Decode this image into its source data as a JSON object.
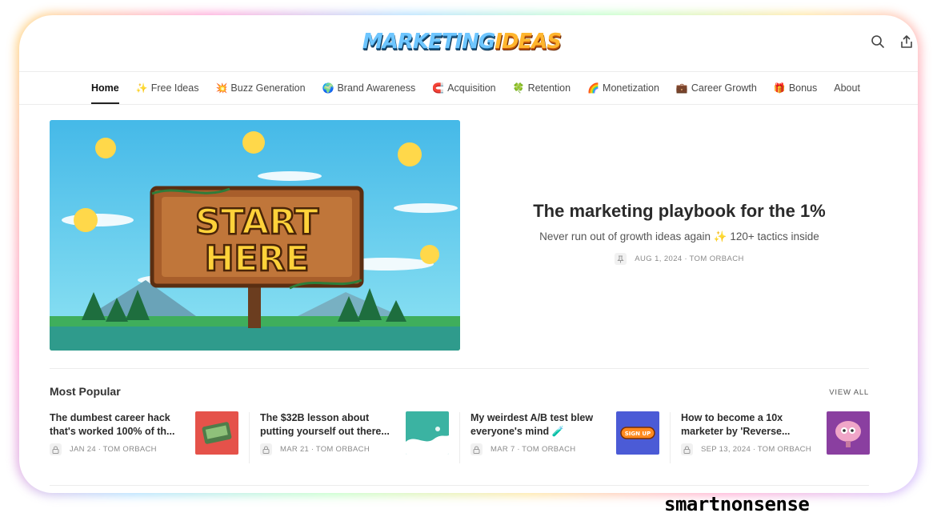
{
  "header": {
    "logo_part1": "MARKETING",
    "logo_part2": "IDEAS"
  },
  "nav": {
    "items": [
      {
        "emoji": "",
        "label": "Home"
      },
      {
        "emoji": "✨",
        "label": "Free Ideas"
      },
      {
        "emoji": "💥",
        "label": "Buzz Generation"
      },
      {
        "emoji": "🌍",
        "label": "Brand Awareness"
      },
      {
        "emoji": "🧲",
        "label": "Acquisition"
      },
      {
        "emoji": "🍀",
        "label": "Retention"
      },
      {
        "emoji": "🌈",
        "label": "Monetization"
      },
      {
        "emoji": "💼",
        "label": "Career Growth"
      },
      {
        "emoji": "🎁",
        "label": "Bonus"
      },
      {
        "emoji": "",
        "label": "About"
      }
    ]
  },
  "hero": {
    "image_line1": "START",
    "image_line2": "HERE",
    "title": "The marketing playbook for the 1%",
    "subtitle": "Never run out of growth ideas again ✨ 120+ tactics inside",
    "meta": "AUG 1, 2024 ∙ TOM ORBACH"
  },
  "popular": {
    "heading": "Most Popular",
    "view_all": "VIEW ALL",
    "cards": [
      {
        "title": "The dumbest career hack that's worked 100% of th...",
        "meta": "JAN 24 ∙ TOM ORBACH",
        "thumb_color": "#e5524a"
      },
      {
        "title": "The $32B lesson about putting yourself out there...",
        "meta": "MAR 21 ∙ TOM ORBACH",
        "thumb_color": "#3bb3a2"
      },
      {
        "title": "My weirdest A/B test blew everyone's mind 🧪",
        "meta": "MAR 7 ∙ TOM ORBACH",
        "thumb_color": "#4b5bd6",
        "thumb_text": "SIGN UP"
      },
      {
        "title": "How to become a 10x marketer by 'Reverse...",
        "meta": "SEP 13, 2024 ∙ TOM ORBACH",
        "thumb_color": "#8a3fa0"
      }
    ]
  },
  "watermark": "smartnonsense"
}
